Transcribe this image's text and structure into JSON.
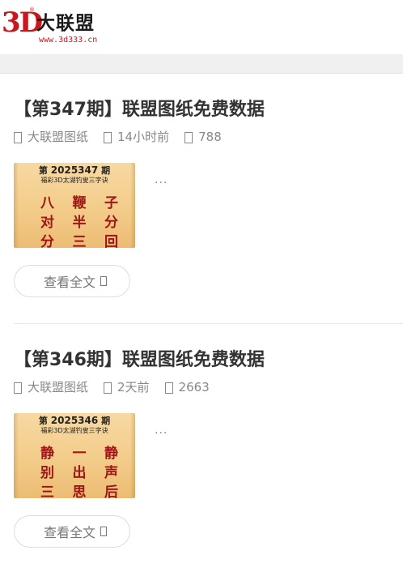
{
  "header": {
    "logo_mark": "3D",
    "logo_reg": "®",
    "logo_name": "大联盟",
    "logo_url": "www.3d333.cn"
  },
  "articles": [
    {
      "title": "【第347期】联盟图纸免费数据",
      "category": "大联盟图纸",
      "time": "14小时前",
      "views": "788",
      "thumb_prefix": "第",
      "thumb_issue": "2025347",
      "thumb_suffix": "期",
      "thumb_subtitle": "福彩3D太湖钓叟三字诀",
      "thumb_rows": [
        [
          "八",
          "鞭",
          "子"
        ],
        [
          "对",
          "半",
          "分"
        ],
        [
          "分",
          "三",
          "回"
        ]
      ],
      "excerpt": "...",
      "read_more": "查看全文"
    },
    {
      "title": "【第346期】联盟图纸免费数据",
      "category": "大联盟图纸",
      "time": "2天前",
      "views": "2663",
      "thumb_prefix": "第",
      "thumb_issue": "2025346",
      "thumb_suffix": "期",
      "thumb_subtitle": "福彩3D太湖钓叟三字诀",
      "thumb_rows": [
        [
          "静",
          "一",
          "静"
        ],
        [
          "别",
          "出",
          "声"
        ],
        [
          "三",
          "思",
          "后"
        ]
      ],
      "excerpt": "...",
      "read_more": "查看全文"
    }
  ],
  "colors": {
    "brand_red": "#c8171e",
    "thumb_text_red": "#a01616",
    "meta_gray": "#888888",
    "band_gray": "#f0f0f0"
  },
  "icons": {
    "category": "folder-icon",
    "time": "clock-icon",
    "views": "eye-icon",
    "read_more": "chevron-right-icon"
  }
}
